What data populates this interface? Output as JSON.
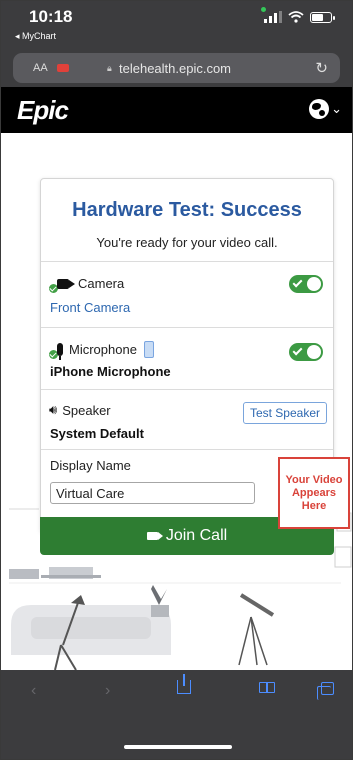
{
  "status_bar": {
    "time": "10:18",
    "back_app": "◂ MyChart"
  },
  "browser": {
    "text_size_label": "AA",
    "url": "telehealth.epic.com",
    "reload_glyph": "↻"
  },
  "header": {
    "logo_text": "Epic",
    "language_chevron": "⌄"
  },
  "card": {
    "title": "Hardware Test: Success",
    "subtitle": "You're ready for your video call.",
    "camera": {
      "label": "Camera",
      "value": "Front Camera",
      "enabled": true
    },
    "microphone": {
      "label": "Microphone",
      "value": "iPhone Microphone",
      "enabled": true
    },
    "speaker": {
      "label": "Speaker",
      "value": "System Default",
      "test_label": "Test Speaker"
    },
    "display_name": {
      "label": "Display Name",
      "value": "Virtual Care"
    },
    "join_label": "Join Call"
  },
  "video_placeholder": "Your Video Appears Here",
  "toolbar": {
    "back_glyph": "‹",
    "forward_glyph": "›"
  },
  "colors": {
    "title_blue": "#2b5aa0",
    "success_green": "#2e7d32",
    "toggle_green": "#3c9a43",
    "placeholder_red": "#d9433a",
    "chrome_dark": "#3c3c3e"
  }
}
